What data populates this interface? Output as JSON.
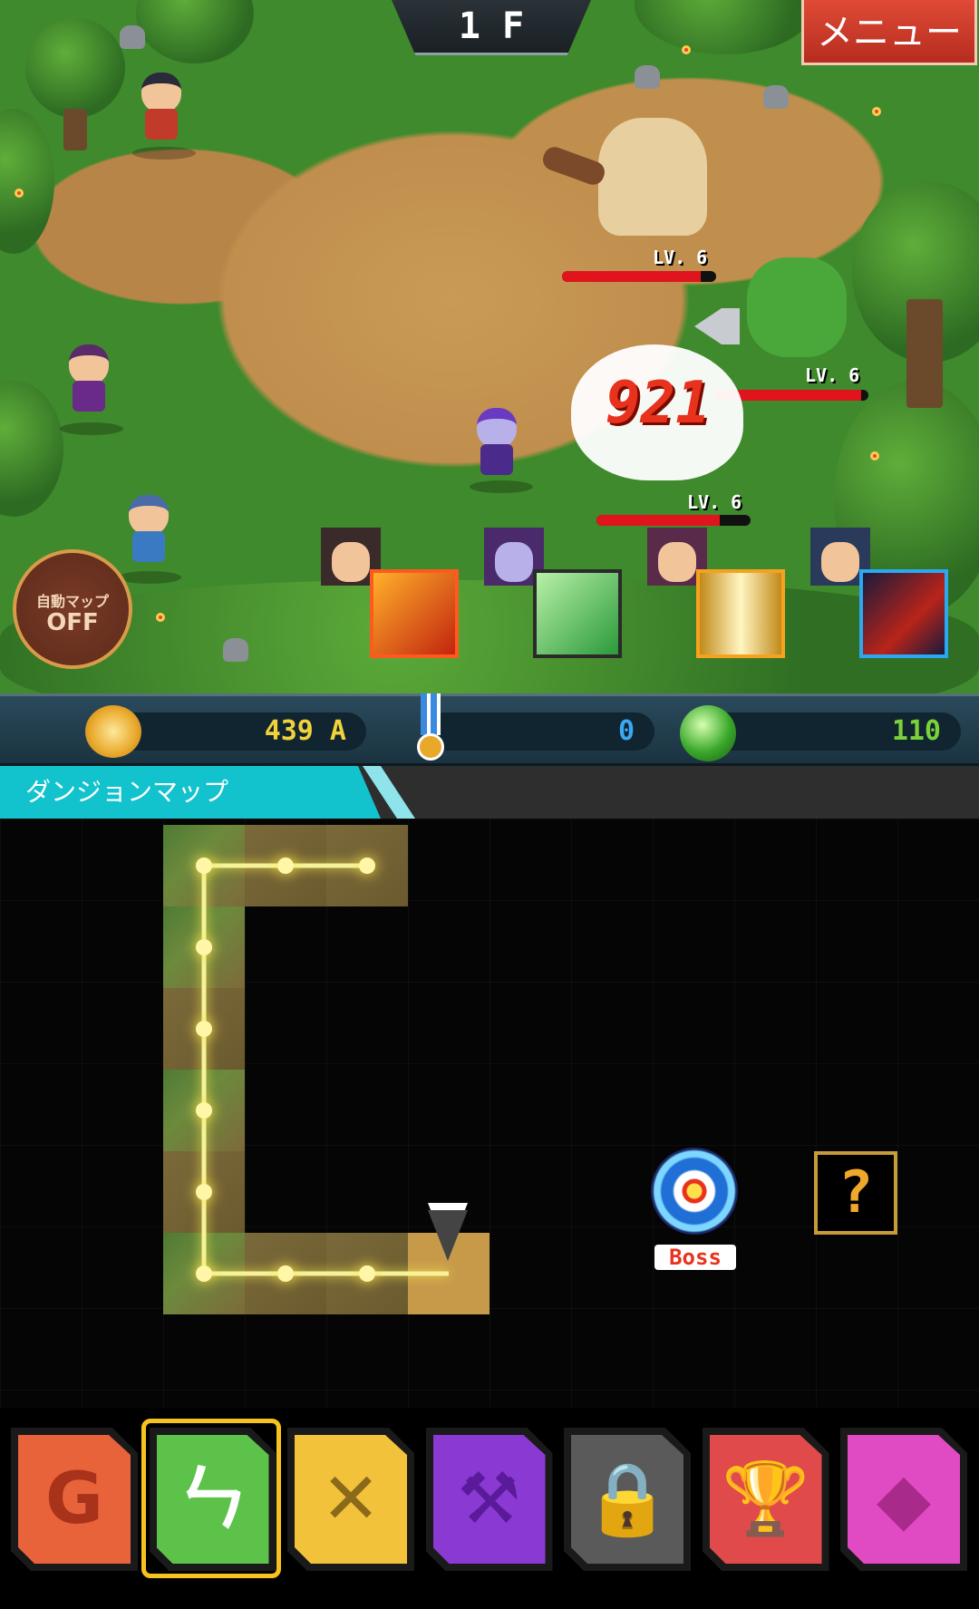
{
  "battle": {
    "floor": "1 F",
    "menu_label": "メニュー",
    "auto_map": {
      "label": "自動マップ",
      "state": "OFF"
    },
    "damage_number": "921",
    "enemies": [
      {
        "name": "cyclops",
        "level_label": "LV. 6",
        "hp_fraction": 0.9
      },
      {
        "name": "orc",
        "level_label": "LV. 6",
        "hp_fraction": 0.95
      },
      {
        "name": "ghost",
        "level_label": "LV. 6",
        "hp_fraction": 0.8
      }
    ],
    "party": [
      {
        "name": "warrior-hero",
        "skill": "flame-sword",
        "skill_color": "#e8321e"
      },
      {
        "name": "mage-girl",
        "skill": "green-blade",
        "skill_color": "#34b24a"
      },
      {
        "name": "priest",
        "skill": "holy-light",
        "skill_color": "#f6c21e"
      },
      {
        "name": "viking",
        "skill": "dragon-claw",
        "skill_color": "#2a8fe0"
      }
    ]
  },
  "currency": {
    "gold": {
      "value": "439 A",
      "icon": "coin-icon",
      "color": "#f2d23a"
    },
    "medals": {
      "value": "0",
      "icon": "medal-icon",
      "color": "#3aa8f2"
    },
    "gems": {
      "value": "110",
      "icon": "green-gem-icon",
      "color": "#7ad23a"
    }
  },
  "map": {
    "tab_label": "ダンジョンマップ",
    "boss_label": "Boss",
    "mystery_label": "?"
  },
  "nav": [
    {
      "name": "gold-tab",
      "glyph": "G",
      "color": "#e8623a",
      "glyph_color": "#a8321a",
      "icon": "g-coin-icon"
    },
    {
      "name": "map-tab",
      "glyph": "ㄣ",
      "color": "#5cc24a",
      "glyph_color": "#ffffff",
      "icon": "path-icon",
      "selected": true
    },
    {
      "name": "battle-tab",
      "glyph": "✕",
      "color": "#f2c23a",
      "glyph_color": "#8a6a1a",
      "icon": "crossed-swords-icon"
    },
    {
      "name": "equipment-tab",
      "glyph": "⚒",
      "color": "#8a3ad2",
      "glyph_color": "#5a1a9a",
      "icon": "battle-axe-icon"
    },
    {
      "name": "locked-tab",
      "glyph": "🔒",
      "color": "#5a5a5a",
      "glyph_color": "#9a9a9a",
      "icon": "lock-icon"
    },
    {
      "name": "ranking-tab",
      "glyph": "🏆",
      "color": "#e04a4a",
      "glyph_color": "#9a1a1a",
      "icon": "trophy-icon"
    },
    {
      "name": "shop-tab",
      "glyph": "◆",
      "color": "#e04ac2",
      "glyph_color": "#a82a8a",
      "icon": "diamond-icon"
    }
  ]
}
